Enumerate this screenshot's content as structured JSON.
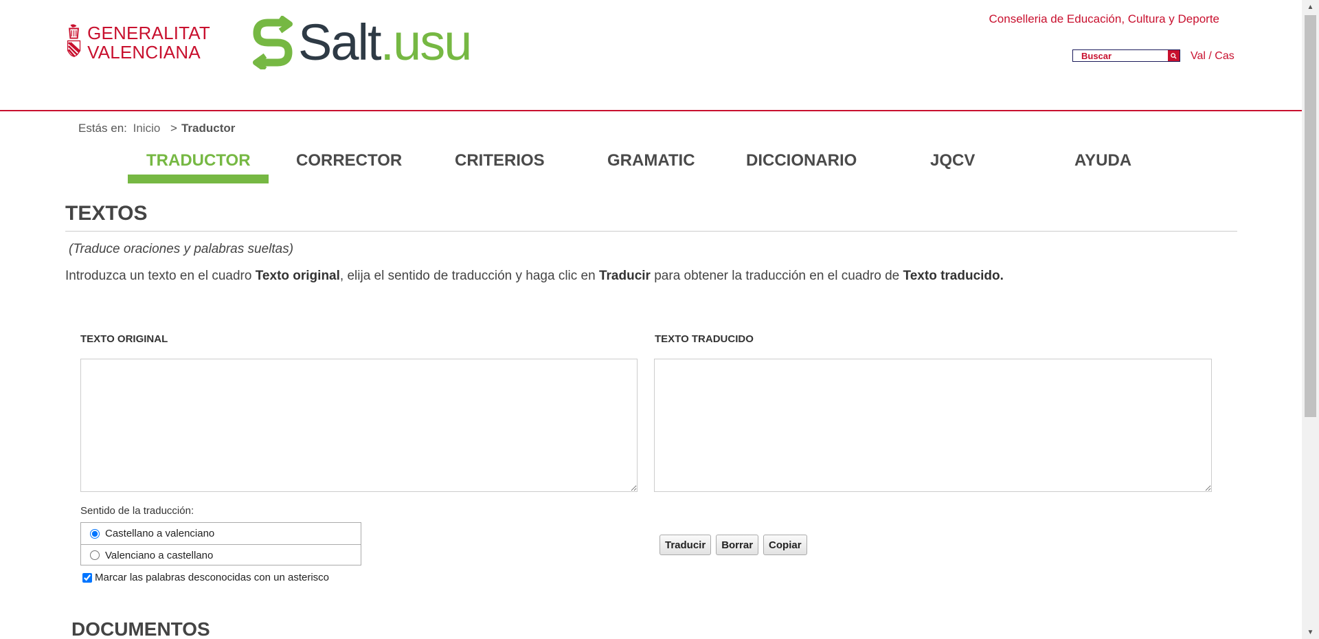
{
  "header": {
    "gva_line1": "GENERALITAT",
    "gva_line2": "VALENCIANA",
    "salt_dark": "Salt",
    "salt_green": ".usu",
    "conselleria": "Conselleria de Educación, Cultura y Deporte",
    "search_placeholder": "Buscar",
    "lang_val": "Val",
    "lang_sep": " / ",
    "lang_cas": "Cas",
    "brand_red": "#c8102e",
    "brand_green": "#76b843"
  },
  "breadcrumb": {
    "prefix": "Estás en:",
    "home": "Inicio",
    "sep": ">",
    "current": "Traductor"
  },
  "tabs": [
    {
      "label": "TRADUCTOR",
      "active": true
    },
    {
      "label": "CORRECTOR"
    },
    {
      "label": "CRITERIOS"
    },
    {
      "label": "GRAMATIC"
    },
    {
      "label": "DICCIONARIO"
    },
    {
      "label": "JQCV"
    },
    {
      "label": "AYUDA"
    }
  ],
  "main": {
    "title": "TEXTOS",
    "subtitle": "(Traduce oraciones y palabras sueltas)",
    "intro": {
      "p1": "Introduzca un texto en el cuadro ",
      "b1": "Texto original",
      "p2": ", elija el sentido de traducción y haga clic en ",
      "b2": "Traducir",
      "p3": " para obtener la traducción en el cuadro de ",
      "b3": "Texto traducido."
    },
    "label_original": "TEXTO ORIGINAL",
    "label_traducido": "TEXTO TRADUCIDO",
    "original_value": "",
    "traducido_value": "",
    "sentido_label": "Sentido de la traducción:",
    "option1": "Castellano a valenciano",
    "option2": "Valenciano a castellano",
    "selected_option": "option1",
    "asterisk_label": "Marcar las palabras desconocidas con un asterisco",
    "asterisk_checked": true,
    "btn_traducir": "Traducir",
    "btn_borrar": "Borrar",
    "btn_copiar": "Copiar",
    "next_section": "DOCUMENTOS"
  },
  "icons": {
    "search": "search-icon",
    "scroll_up": "chevron-up-icon",
    "scroll_down": "chevron-down-icon"
  }
}
